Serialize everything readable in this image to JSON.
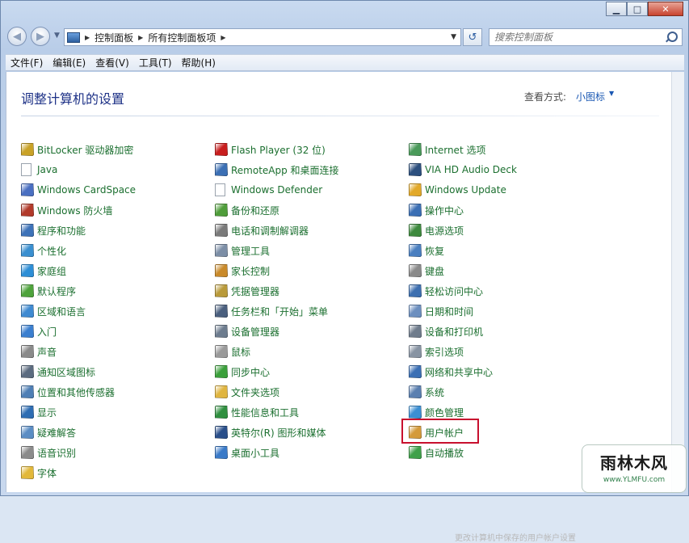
{
  "window": {
    "minimize_glyph": "▁",
    "maximize_glyph": "□",
    "close_glyph": "✕"
  },
  "address": {
    "crumbs": [
      "控制面板",
      "所有控制面板项"
    ],
    "separator_glyph": "▶",
    "dropdown_glyph": "▼"
  },
  "nav": {
    "back_glyph": "◀",
    "forward_glyph": "▶",
    "history_glyph": "▼",
    "refresh_glyph": "↺"
  },
  "search": {
    "placeholder": "搜索控制面板"
  },
  "menu": [
    "文件(F)",
    "编辑(E)",
    "查看(V)",
    "工具(T)",
    "帮助(H)"
  ],
  "header": {
    "title": "调整计算机的设置",
    "view_label": "查看方式:",
    "view_value": "小图标",
    "view_caret": "▼"
  },
  "columns": [
    [
      {
        "label": "BitLocker 驱动器加密",
        "icon": "bitlocker-icon",
        "color": "#c9a227"
      },
      {
        "label": "Java",
        "icon": "java-icon",
        "color": "#ffffff"
      },
      {
        "label": "Windows CardSpace",
        "icon": "cardspace-icon",
        "color": "#4a6fc1"
      },
      {
        "label": "Windows 防火墙",
        "icon": "firewall-icon",
        "color": "#b23a2a"
      },
      {
        "label": "程序和功能",
        "icon": "programs-icon",
        "color": "#3d72b8"
      },
      {
        "label": "个性化",
        "icon": "personalization-icon",
        "color": "#3a8fd0"
      },
      {
        "label": "家庭组",
        "icon": "homegroup-icon",
        "color": "#2d8ed6"
      },
      {
        "label": "默认程序",
        "icon": "default-programs-icon",
        "color": "#4ea33b"
      },
      {
        "label": "区域和语言",
        "icon": "region-icon",
        "color": "#3f8ad1"
      },
      {
        "label": "入门",
        "icon": "getting-started-icon",
        "color": "#3b7fcf"
      },
      {
        "label": "声音",
        "icon": "sound-icon",
        "color": "#8a8a8a"
      },
      {
        "label": "通知区域图标",
        "icon": "notification-icon",
        "color": "#5c6c80"
      },
      {
        "label": "位置和其他传感器",
        "icon": "sensors-icon",
        "color": "#4f7fb5"
      },
      {
        "label": "显示",
        "icon": "display-icon",
        "color": "#2e6db3"
      },
      {
        "label": "疑难解答",
        "icon": "troubleshooting-icon",
        "color": "#5b8dc4"
      },
      {
        "label": "语音识别",
        "icon": "speech-icon",
        "color": "#8b8b8b"
      },
      {
        "label": "字体",
        "icon": "fonts-icon",
        "color": "#e2b83a"
      }
    ],
    [
      {
        "label": "Flash Player (32 位)",
        "icon": "flash-icon",
        "color": "#c81e1e"
      },
      {
        "label": "RemoteApp 和桌面连接",
        "icon": "remoteapp-icon",
        "color": "#3b6fb4"
      },
      {
        "label": "Windows Defender",
        "icon": "defender-icon",
        "color": "#ffffff"
      },
      {
        "label": "备份和还原",
        "icon": "backup-icon",
        "color": "#4f9d3a"
      },
      {
        "label": "电话和调制解调器",
        "icon": "phone-modem-icon",
        "color": "#7a7a7a"
      },
      {
        "label": "管理工具",
        "icon": "admin-tools-icon",
        "color": "#7c8ea6"
      },
      {
        "label": "家长控制",
        "icon": "parental-controls-icon",
        "color": "#c98a2a"
      },
      {
        "label": "凭据管理器",
        "icon": "credential-icon",
        "color": "#b99a3a"
      },
      {
        "label": "任务栏和「开始」菜单",
        "icon": "taskbar-icon",
        "color": "#4a5f7e"
      },
      {
        "label": "设备管理器",
        "icon": "device-manager-icon",
        "color": "#6d7c8e"
      },
      {
        "label": "鼠标",
        "icon": "mouse-icon",
        "color": "#9a9a9a"
      },
      {
        "label": "同步中心",
        "icon": "sync-icon",
        "color": "#3ba03b"
      },
      {
        "label": "文件夹选项",
        "icon": "folder-options-icon",
        "color": "#e0b540"
      },
      {
        "label": "性能信息和工具",
        "icon": "performance-icon",
        "color": "#2f8f3f"
      },
      {
        "label": "英特尔(R) 图形和媒体",
        "icon": "intel-graphics-icon",
        "color": "#2a4f8a"
      },
      {
        "label": "桌面小工具",
        "icon": "gadgets-icon",
        "color": "#3a7ac8"
      }
    ],
    [
      {
        "label": "Internet 选项",
        "icon": "internet-options-icon",
        "color": "#4a9a5a"
      },
      {
        "label": "VIA HD Audio Deck",
        "icon": "via-audio-icon",
        "color": "#2c4f7e"
      },
      {
        "label": "Windows Update",
        "icon": "windows-update-icon",
        "color": "#e2a92a"
      },
      {
        "label": "操作中心",
        "icon": "action-center-icon",
        "color": "#3b6fb4"
      },
      {
        "label": "电源选项",
        "icon": "power-options-icon",
        "color": "#3e8a3e"
      },
      {
        "label": "恢复",
        "icon": "recovery-icon",
        "color": "#4a7fc0"
      },
      {
        "label": "键盘",
        "icon": "keyboard-icon",
        "color": "#8a8a8a"
      },
      {
        "label": "轻松访问中心",
        "icon": "ease-of-access-icon",
        "color": "#3d6fb0"
      },
      {
        "label": "日期和时间",
        "icon": "date-time-icon",
        "color": "#6c8fbf"
      },
      {
        "label": "设备和打印机",
        "icon": "devices-printers-icon",
        "color": "#6f7c8c"
      },
      {
        "label": "索引选项",
        "icon": "indexing-icon",
        "color": "#8894a3"
      },
      {
        "label": "网络和共享中心",
        "icon": "network-icon",
        "color": "#3b6fb4"
      },
      {
        "label": "系统",
        "icon": "system-icon",
        "color": "#5a7fb0"
      },
      {
        "label": "颜色管理",
        "icon": "color-management-icon",
        "color": "#3b8fd3"
      },
      {
        "label": "用户帐户",
        "icon": "user-accounts-icon",
        "color": "#d49a3a"
      },
      {
        "label": "自动播放",
        "icon": "autoplay-icon",
        "color": "#3fa04a"
      }
    ]
  ],
  "watermark": {
    "main": "雨林木风",
    "url": "www.YLMFU.com"
  },
  "ghost_text": "更改计算机中保存的用户帐户设置"
}
